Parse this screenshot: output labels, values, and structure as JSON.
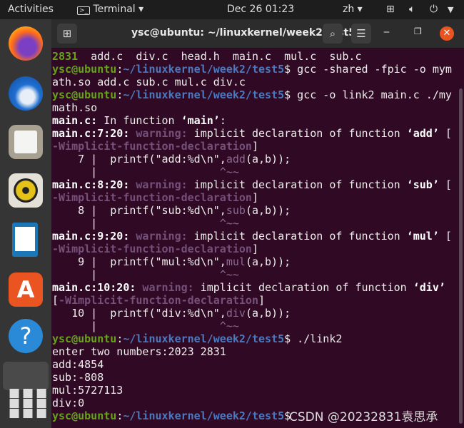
{
  "topbar": {
    "activities": "Activities",
    "app": "Terminal",
    "clock": "Dec 26  01:23",
    "lang": "zh"
  },
  "dock": {
    "items": [
      "firefox",
      "thunderbird",
      "files",
      "rhythmbox",
      "libreoffice-writer",
      "software",
      "help",
      "terminal",
      "show-apps"
    ]
  },
  "window": {
    "title": "ysc@ubuntu: ~/linuxkernel/week2/test5"
  },
  "colors": {
    "background": "#300a24",
    "prompt_user": "#66a31b",
    "prompt_path": "#4a79c0",
    "warning": "#75507b"
  },
  "terminal": {
    "lines": [
      [
        [
          "2831",
          "g"
        ],
        [
          "  add.c  div.c  head.h  main.c  mul.c  sub.c",
          "n"
        ]
      ],
      [
        [
          "ysc@ubuntu",
          "g"
        ],
        [
          ":",
          "n"
        ],
        [
          "~/linuxkernel/week2/test5",
          "b"
        ],
        [
          "$ gcc -shared -fpic -o mym",
          "n"
        ]
      ],
      [
        [
          "ath.so add.c sub.c mul.c div.c",
          "n"
        ]
      ],
      [
        [
          "ysc@ubuntu",
          "g"
        ],
        [
          ":",
          "n"
        ],
        [
          "~/linuxkernel/week2/test5",
          "b"
        ],
        [
          "$ gcc -o link2 main.c ./my",
          "n"
        ]
      ],
      [
        [
          "math.so",
          "n"
        ]
      ],
      [
        [
          "main.c:",
          "w"
        ],
        [
          " In function ",
          "n"
        ],
        [
          "‘main’",
          "w"
        ],
        [
          ":",
          "n"
        ]
      ],
      [
        [
          "main.c:7:20:",
          "w"
        ],
        [
          " warning:",
          "m"
        ],
        [
          " implicit declaration of function ",
          "n"
        ],
        [
          "‘add’",
          "w"
        ],
        [
          " [",
          "n"
        ]
      ],
      [
        [
          "-Wimplicit-function-declaration",
          "m"
        ],
        [
          "]",
          "n"
        ]
      ],
      [
        [
          "    7 |  printf(\"add:%d\\n\",",
          "n"
        ],
        [
          "add",
          "p"
        ],
        [
          "(a,b));",
          "n"
        ]
      ],
      [
        [
          "      |                   ",
          "n"
        ],
        [
          "^~~",
          "p"
        ]
      ],
      [
        [
          "main.c:8:20:",
          "w"
        ],
        [
          " warning:",
          "m"
        ],
        [
          " implicit declaration of function ",
          "n"
        ],
        [
          "‘sub’",
          "w"
        ],
        [
          " [",
          "n"
        ]
      ],
      [
        [
          "-Wimplicit-function-declaration",
          "m"
        ],
        [
          "]",
          "n"
        ]
      ],
      [
        [
          "    8 |  printf(\"sub:%d\\n\",",
          "n"
        ],
        [
          "sub",
          "p"
        ],
        [
          "(a,b));",
          "n"
        ]
      ],
      [
        [
          "      |                   ",
          "n"
        ],
        [
          "^~~",
          "p"
        ]
      ],
      [
        [
          "main.c:9:20:",
          "w"
        ],
        [
          " warning:",
          "m"
        ],
        [
          " implicit declaration of function ",
          "n"
        ],
        [
          "‘mul’",
          "w"
        ],
        [
          " [",
          "n"
        ]
      ],
      [
        [
          "-Wimplicit-function-declaration",
          "m"
        ],
        [
          "]",
          "n"
        ]
      ],
      [
        [
          "    9 |  printf(\"mul:%d\\n\",",
          "n"
        ],
        [
          "mul",
          "p"
        ],
        [
          "(a,b));",
          "n"
        ]
      ],
      [
        [
          "      |                   ",
          "n"
        ],
        [
          "^~~",
          "p"
        ]
      ],
      [
        [
          "main.c:10:20:",
          "w"
        ],
        [
          " warning:",
          "m"
        ],
        [
          " implicit declaration of function ",
          "n"
        ],
        [
          "‘div’",
          "w"
        ]
      ],
      [
        [
          "[",
          "n"
        ],
        [
          "-Wimplicit-function-declaration",
          "m"
        ],
        [
          "]",
          "n"
        ]
      ],
      [
        [
          "   10 |  printf(\"div:%d\\n\",",
          "n"
        ],
        [
          "div",
          "p"
        ],
        [
          "(a,b));",
          "n"
        ]
      ],
      [
        [
          "      |                   ",
          "n"
        ],
        [
          "^~~",
          "p"
        ]
      ],
      [
        [
          "ysc@ubuntu",
          "g"
        ],
        [
          ":",
          "n"
        ],
        [
          "~/linuxkernel/week2/test5",
          "b"
        ],
        [
          "$ ./link2",
          "n"
        ]
      ],
      [
        [
          "enter two numbers:2023 2831",
          "n"
        ]
      ],
      [
        [
          "add:4854",
          "n"
        ]
      ],
      [
        [
          "sub:-808",
          "n"
        ]
      ],
      [
        [
          "mul:5727113",
          "n"
        ]
      ],
      [
        [
          "div:0",
          "n"
        ]
      ],
      [
        [
          "ysc@ubuntu",
          "g"
        ],
        [
          ":",
          "n"
        ],
        [
          "~/linuxkernel/week2/test5",
          "b"
        ],
        [
          "$",
          "n"
        ]
      ]
    ]
  },
  "watermark": "CSDN @20232831袁思承"
}
